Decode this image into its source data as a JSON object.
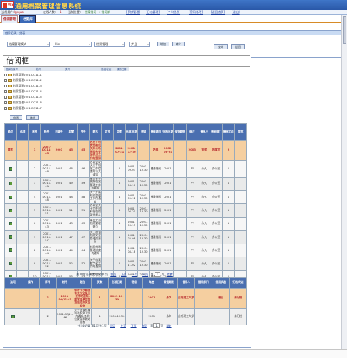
{
  "app": {
    "title": "通用档案管理信息系统",
    "logo_text": "MIS"
  },
  "infobar": {
    "user_label": "当前用户:",
    "user_value": "lgsquo",
    "online_label": "在线人数:",
    "online_value": "1",
    "position_label": "当前位置:",
    "position_value": "档案借阅 -> 借阅单",
    "links": [
      "[系统管理]",
      "[日志管理]",
      "[个人信息]",
      "[密码修改]",
      "[返回首页]",
      "[退出]"
    ]
  },
  "tabs": [
    {
      "label": "借阅管理",
      "active": true
    },
    {
      "label": "档案库",
      "active": false
    }
  ],
  "panel": {
    "title": "借阅记录一览表"
  },
  "query": {
    "field_select": "档案管理模式",
    "op_select": "like",
    "value_select": "档案管理",
    "logic_select": "并且",
    "add_btn": "增加",
    "reduce_btn": "减少",
    "search_btn": "查询",
    "reset_btn": "返回"
  },
  "big_title": "借阅框",
  "tree": {
    "headers": [
      "借阅档案号",
      "档号",
      "类号",
      "借阅状态",
      "操作日期"
    ],
    "items": [
      "档案管理2001-DQ11-1",
      "档案管理2001-DQ11-2",
      "档案管理2001-DQ11-3",
      "档案管理2001-DQ11-4",
      "档案管理2001-DQ11-5",
      "档案管理2001-DQ11-6",
      "档案管理2001-DQ11-7"
    ],
    "buttons": [
      "借阅",
      "移除"
    ]
  },
  "grid1": {
    "headers": [
      "修改",
      "选项",
      "序号",
      "档号",
      "目录号",
      "年度",
      "件号",
      "题名",
      "文号",
      "页数",
      "形成日期",
      "密级",
      "借阅理由",
      "归档日期",
      "保管期限",
      "备注",
      "借阅人",
      "借阅部门",
      "借阅状态",
      "审批"
    ],
    "highlight": [
      "审批",
      "",
      "1",
      "2001-DQ11-45",
      "2001",
      "45",
      "45",
      "办关于切实加强机关办公场所综合安全保卫工作的通知",
      "",
      "2001-07-31",
      "2001-12-30",
      "",
      "内部",
      "2002-06-24",
      "",
      "2003",
      "刘健",
      "档案室",
      "2",
      "",
      "",
      "借出",
      "未归档"
    ],
    "rows": [
      [
        "",
        "",
        "2",
        "2001-DQ11-46",
        "2001",
        "46",
        "46",
        "办公室发文关于档案工作检查的有关通知",
        "",
        "1",
        "2001-09-03",
        "2001-12-30",
        "普通借阅",
        "2001",
        "",
        "中",
        "永久",
        "办公室",
        "1",
        "",
        "未归档"
      ],
      [
        "",
        "",
        "3",
        "2001-DQ11-49",
        "2001",
        "49",
        "49",
        "单位关于做好档案管理工作的通知",
        "",
        "1",
        "2001-04-10",
        "2001-12-30",
        "普通借阅",
        "2001",
        "",
        "中",
        "永久",
        "办公室",
        "1",
        "",
        "未归档"
      ],
      [
        "",
        "",
        "4",
        "2001-DQ11-48",
        "2001",
        "48",
        "48",
        "关于开展档案整理工作的通知",
        "",
        "1",
        "2001-05-12",
        "2001-12-30",
        "普通借阅",
        "2001",
        "",
        "中",
        "永久",
        "办公室",
        "1",
        "",
        "未归档"
      ],
      [
        "",
        "",
        "5",
        "2001-DQ11-51",
        "2001",
        "51",
        "51",
        "办公室关于文件材料归档的暂行规定",
        "",
        "1",
        "2001-06-20",
        "2001-12-30",
        "普通借阅",
        "2001",
        "",
        "中",
        "永久",
        "办公室",
        "1",
        "",
        "未归档"
      ],
      [
        "",
        "",
        "6",
        "2001-DQ11-43",
        "2001",
        "43",
        "43",
        "单位文书档案整理规范",
        "",
        "1",
        "2001-03-15",
        "2001-12-30",
        "普通借阅",
        "2001",
        "",
        "中",
        "永久",
        "办公室",
        "1",
        "",
        "未归档"
      ],
      [
        "",
        "",
        "7",
        "2001-DQ11-47",
        "2001",
        "47",
        "47",
        "关于加强档案安全管理的意见",
        "",
        "1",
        "2001-02-08",
        "2001-12-30",
        "普通借阅",
        "2001",
        "",
        "中",
        "永久",
        "办公室",
        "1",
        "",
        "未归档"
      ],
      [
        "",
        "",
        "8",
        "2001-DQ11-44",
        "2001",
        "44",
        "44",
        "档案借阅管理制度的通知",
        "",
        "1",
        "2001-08-18",
        "2001-12-30",
        "普通借阅",
        "2001",
        "",
        "中",
        "永久",
        "办公室",
        "1",
        "",
        "未归档"
      ],
      [
        "",
        "",
        "9",
        "2001-DQ11-52",
        "2001",
        "52",
        "52",
        "关于档案数字化工作的通知",
        "",
        "1",
        "2001-11-02",
        "2001-12-30",
        "普通借阅",
        "2001",
        "",
        "中",
        "永久",
        "办公室",
        "1",
        "",
        "未归档"
      ],
      [
        "",
        "",
        "10",
        "2001-DQ11-53",
        "2001",
        "53",
        "53",
        "年度档案工作总结",
        "",
        "1",
        "2001-12-01",
        "2001-12-30",
        "普通借阅",
        "2001",
        "",
        "中",
        "永久",
        "办公室",
        "1",
        "",
        "未归档"
      ]
    ]
  },
  "pager1": {
    "summary": "共10条记录 第1页/共1页",
    "links": [
      "首页",
      "上页",
      "下页",
      "末页"
    ],
    "page_label": "第",
    "page_value": "1",
    "page_unit": "页",
    "go": "跳转"
  },
  "grid2": {
    "headers": [
      "选项",
      "操作",
      "序号",
      "档号",
      "题名",
      "页数",
      "形成日期",
      "密级",
      "年度",
      "保管期限",
      "借阅人",
      "借阅部门",
      "借阅状态",
      "归档状态"
    ],
    "highlight": [
      "",
      "",
      "1",
      "2001-DQ11-45",
      "做好节日期间有关安全保卫工作的通知,要求各单位加强值班和安全检查",
      "1",
      "2001-12-30",
      "",
      "2001",
      "永久",
      "山东理工大学",
      "",
      "借出",
      "未归档"
    ],
    "rows": [
      [
        "",
        "",
        "2",
        "2001-DQ11-46",
        "关于开展档案执法检查工作的通知,各单位按要求做好自查",
        "1",
        "2001-12-30",
        "",
        "2001",
        "永久",
        "山东理工大学",
        "",
        "",
        "未归档"
      ]
    ]
  },
  "pager2": {
    "summary": "共2条记录 第1页/共1页",
    "links": [
      "首页",
      "上页",
      "下页",
      "末页"
    ],
    "page_label": "第",
    "page_value": "1",
    "page_unit": "页",
    "go": "跳转"
  }
}
